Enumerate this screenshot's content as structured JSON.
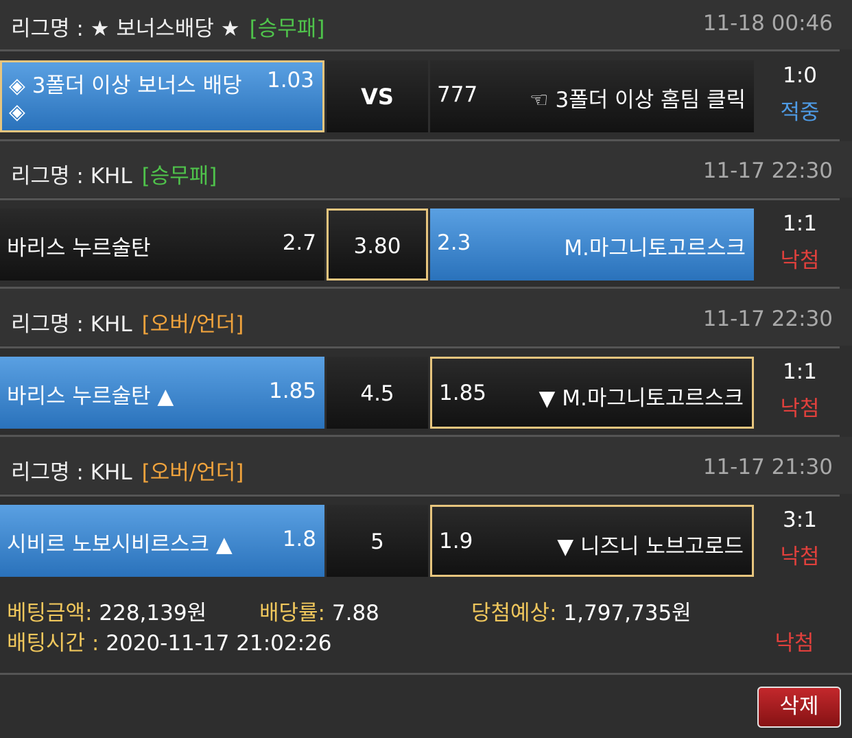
{
  "colors": {
    "selected_blue": "#3a86cf",
    "selected_border": "#e7c57e",
    "win_color": "#4e9be5",
    "lose_color": "#e0403c",
    "tag_green": "#4fc34b",
    "tag_orange": "#f0a33c",
    "footer_label": "#f0c75c"
  },
  "bets": [
    {
      "league_label": "리그명 : ★ 보너스배당 ★",
      "bet_type": "[승무패]",
      "datetime": "11-18 00:46",
      "home_name": "◈ 3폴더 이상 보너스 배당",
      "home_name_line2": "◈",
      "home_odds": "1.03",
      "middle": "VS",
      "away_odds": "777",
      "away_name": "☜ 3폴더 이상 홈팀 클릭",
      "score": "1:0",
      "result": "적중"
    },
    {
      "league_label": "리그명 : KHL",
      "bet_type": "[승무패]",
      "datetime": "11-17 22:30",
      "home_name": "바리스 누르술탄",
      "home_odds": "2.7",
      "middle": "3.80",
      "away_odds": "2.3",
      "away_name": "M.마그니토고르스크",
      "score": "1:1",
      "result": "낙첨"
    },
    {
      "league_label": "리그명 : KHL",
      "bet_type": "[오버/언더]",
      "datetime": "11-17 22:30",
      "home_name": "바리스 누르술탄 ▲",
      "home_odds": "1.85",
      "middle": "4.5",
      "away_odds": "1.85",
      "away_name": "▼ M.마그니토고르스크",
      "score": "1:1",
      "result": "낙첨"
    },
    {
      "league_label": "리그명 : KHL",
      "bet_type": "[오버/언더]",
      "datetime": "11-17 21:30",
      "home_name": "시비르 노보시비르스크 ▲",
      "home_odds": "1.8",
      "middle": "5",
      "away_odds": "1.9",
      "away_name": "▼ 니즈니 노브고로드",
      "score": "3:1",
      "result": "낙첨"
    }
  ],
  "summary": {
    "bet_amount_label": "베팅금액:",
    "bet_amount": "228,139원",
    "odds_label": "배당률:",
    "odds": "7.88",
    "expected_label": "당첨예상:",
    "expected": "1,797,735원",
    "time_label": "배팅시간 :",
    "time": "2020-11-17 21:02:26",
    "final_result": "낙첨"
  },
  "actions": {
    "delete_label": "삭제"
  }
}
